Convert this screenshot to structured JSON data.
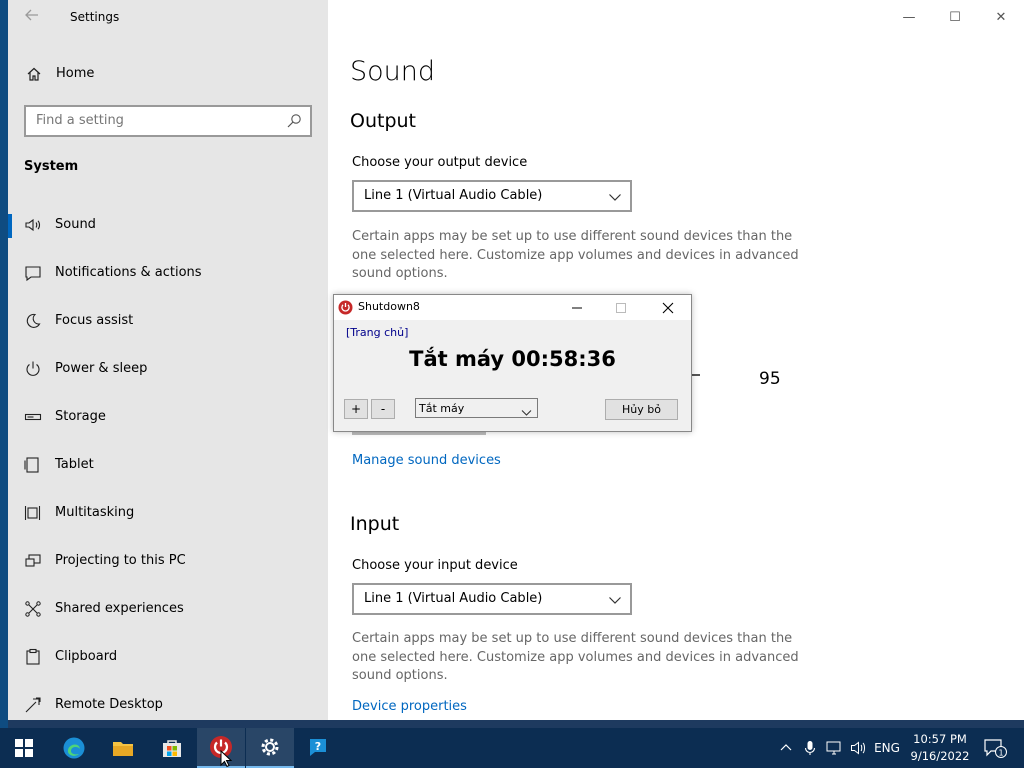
{
  "window": {
    "app_title": "Settings",
    "controls": {
      "minimize": "—",
      "maximize": "☐",
      "close": "✕"
    }
  },
  "sidebar": {
    "home_label": "Home",
    "search_placeholder": "Find a setting",
    "section_heading": "System",
    "items": [
      {
        "label": "Sound",
        "icon": "speaker-icon",
        "active": true
      },
      {
        "label": "Notifications & actions",
        "icon": "notification-icon"
      },
      {
        "label": "Focus assist",
        "icon": "moon-icon"
      },
      {
        "label": "Power & sleep",
        "icon": "power-icon"
      },
      {
        "label": "Storage",
        "icon": "storage-icon"
      },
      {
        "label": "Tablet",
        "icon": "tablet-icon"
      },
      {
        "label": "Multitasking",
        "icon": "multitasking-icon"
      },
      {
        "label": "Projecting to this PC",
        "icon": "projecting-icon"
      },
      {
        "label": "Shared experiences",
        "icon": "shared-icon"
      },
      {
        "label": "Clipboard",
        "icon": "clipboard-icon"
      },
      {
        "label": "Remote Desktop",
        "icon": "remote-desktop-icon"
      }
    ]
  },
  "main": {
    "page_title": "Sound",
    "output": {
      "title": "Output",
      "device_label": "Choose your output device",
      "device_value": "Line 1 (Virtual Audio Cable)",
      "description": "Certain apps may be set up to use different sound devices than the one selected here. Customize app volumes and devices in advanced sound options.",
      "volume_value": "95",
      "manage_link": "Manage sound devices"
    },
    "input": {
      "title": "Input",
      "device_label": "Choose your input device",
      "device_value": "Line 1 (Virtual Audio Cable)",
      "description": "Certain apps may be set up to use different sound devices than the one selected here. Customize app volumes and devices in advanced sound options.",
      "properties_link": "Device properties"
    }
  },
  "dialog": {
    "title": "Shutdown8",
    "home_link": "[Trang chủ]",
    "timer": "Tắt máy 00:58:36",
    "plus": "+",
    "minus": "-",
    "action_value": "Tắt máy",
    "cancel": "Hủy bỏ"
  },
  "taskbar": {
    "apps": [
      "windows-start-icon",
      "edge-icon",
      "file-explorer-icon",
      "store-icon",
      "shutdown8-icon",
      "settings-gear-icon",
      "help-icon"
    ],
    "language": "ENG",
    "time": "10:57 PM",
    "date": "9/16/2022",
    "notification_count": "1"
  },
  "colors": {
    "accent": "#0067c0",
    "sidebar_bg": "#e6e6e6",
    "taskbar_bg": "#0c2d52"
  }
}
